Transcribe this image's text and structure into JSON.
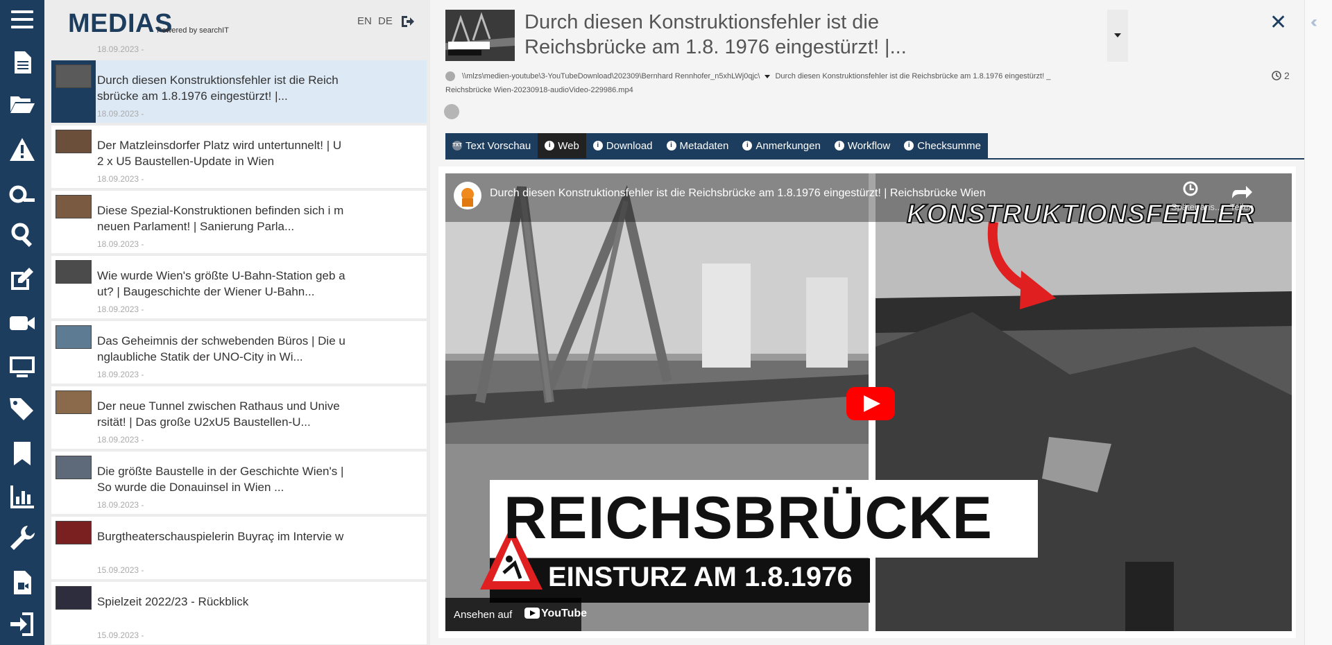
{
  "app": {
    "brand": "MEDIAS",
    "brand_sub": "Powered by searchIT",
    "lang_en": "EN",
    "lang_de": "DE"
  },
  "rail": {
    "icons": [
      "menu-icon",
      "document-icon",
      "folder-open-icon",
      "warning-icon",
      "search-key-icon",
      "search-icon",
      "edit-icon",
      "video-camera-icon",
      "monitor-icon",
      "tags-icon",
      "bookmark-icon",
      "bar-chart-icon",
      "wrench-icon",
      "file-video-icon",
      "sign-in-icon"
    ]
  },
  "list": {
    "prev_date": "18.09.2023 -",
    "items": [
      {
        "title": "Durch diesen Konstruktionsfehler ist die Reich sbrücke am 1.8.1976 eingestürzt! |...",
        "date": "18.09.2023 -",
        "active": true
      },
      {
        "title": "Der Matzleinsdorfer Platz wird untertunnelt! | U2 x U5 Baustellen-Update in Wien",
        "date": "18.09.2023 -"
      },
      {
        "title": "Diese Spezial-Konstruktionen befinden sich i m neuen Parlament! | Sanierung Parla...",
        "date": "18.09.2023 -"
      },
      {
        "title": "Wie wurde Wien's größte U-Bahn-Station geb aut? | Baugeschichte der Wiener U-Bahn...",
        "date": "18.09.2023 -"
      },
      {
        "title": "Das Geheimnis der schwebenden Büros | Die unglaubliche Statik der UNO-City in Wi...",
        "date": "18.09.2023 -"
      },
      {
        "title": "Der neue Tunnel zwischen Rathaus und Unive rsität! | Das große U2xU5 Baustellen-U...",
        "date": "18.09.2023 -"
      },
      {
        "title": "Die größte Baustelle in der Geschichte Wien's | So wurde die Donauinsel in Wien ...",
        "date": "18.09.2023 -"
      },
      {
        "title": "Burgtheaterschauspielerin Buyraç im Intervie w",
        "date": "15.09.2023 -"
      },
      {
        "title": "Spielzeit 2022/23 - Rückblick",
        "date": "15.09.2023 -"
      }
    ]
  },
  "detail": {
    "title": "Durch diesen Konstruktionsfehler ist die Reichsbrücke am 1.8. 1976 eingestürzt! |...",
    "path_dir": "\\\\mlzs\\medien-youtube\\3-YouTubeDownload\\202309\\Bernhard Rennhofer_n5xhLWj0qjc\\",
    "path_file": "Durch diesen Konstruktionsfehler ist die Reichsbrücke am 1.8.1976 eingestürzt! _ Reichsbrücke Wien-20230918-audioVideo-229986.mp4",
    "history_count": "2",
    "close": "✕",
    "thumb_label": "REICHSBRÜCKE"
  },
  "tabs": [
    {
      "label": "Text Vorschau",
      "icon": "TXT"
    },
    {
      "label": "Web",
      "icon": "i",
      "active": true
    },
    {
      "label": "Download",
      "icon": "i"
    },
    {
      "label": "Metadaten",
      "icon": "i"
    },
    {
      "label": "Anmerkungen",
      "icon": "i"
    },
    {
      "label": "Workflow",
      "icon": "i"
    },
    {
      "label": "Checksumme",
      "icon": "i"
    }
  ],
  "video": {
    "title": "Durch diesen Konstruktionsfehler ist die Reichsbrücke am 1.8.1976 eingestürzt! | Reichsbrücke Wien",
    "overlay_top": "KONSTRUKTIONSFEHLER",
    "overlay_main": "REICHSBRÜCKE",
    "overlay_sub": "EINSTURZ AM 1.8.1976",
    "watch_later": "Später ans...",
    "share": "Teilen",
    "watch_on": "Ansehen auf",
    "youtube": "YouTube"
  },
  "colors": {
    "accent": "#1d3d5e",
    "active_row": "#dde9f5",
    "youtube_red": "#ff0000"
  }
}
